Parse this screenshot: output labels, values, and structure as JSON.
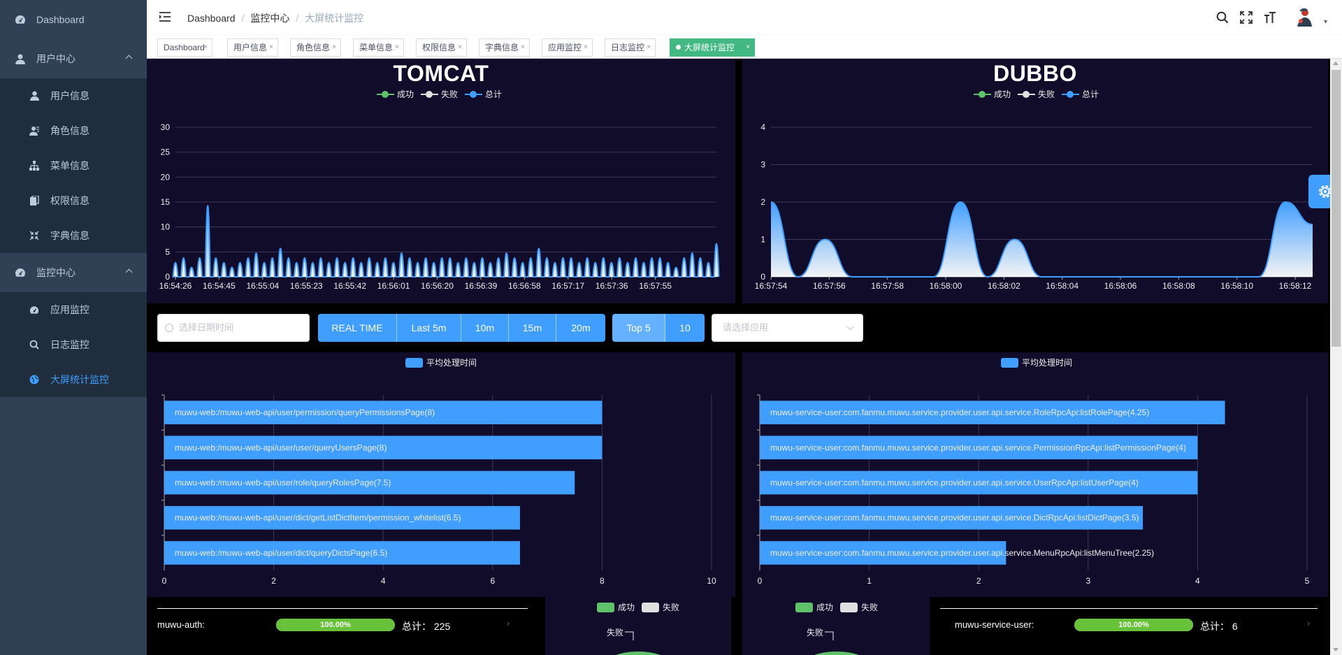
{
  "sidebar": {
    "dashboard": "Dashboard",
    "user_center": "用户中心",
    "user_info": "用户信息",
    "role_info": "角色信息",
    "menu_info": "菜单信息",
    "perm_info": "权限信息",
    "dict_info": "字典信息",
    "monitor_center": "监控中心",
    "app_monitor": "应用监控",
    "log_monitor": "日志监控",
    "screen_monitor": "大屏统计监控"
  },
  "breadcrumb": [
    "Dashboard",
    "监控中心",
    "大屏统计监控"
  ],
  "tags": [
    "Dashboard",
    "用户信息",
    "角色信息",
    "菜单信息",
    "权限信息",
    "字典信息",
    "应用监控",
    "日志监控",
    "大屏统计监控"
  ],
  "toolbar": {
    "date_placeholder": "选择日期时间",
    "range_buttons": [
      "REAL TIME",
      "Last 5m",
      "10m",
      "15m",
      "20m"
    ],
    "top_buttons": [
      "Top 5",
      "10"
    ],
    "app_placeholder": "请选择应用"
  },
  "legend": {
    "success": "成功",
    "fail": "失败",
    "total": "总计"
  },
  "colors": {
    "success": "#5fc26b",
    "fail": "#e0e0e0",
    "total": "#409eff",
    "panel": "#100c2a"
  },
  "chart_data": [
    {
      "type": "area",
      "title": "TOMCAT",
      "x_ticks": [
        "16:54:26",
        "16:54:45",
        "16:55:04",
        "16:55:23",
        "16:55:42",
        "16:56:01",
        "16:56:20",
        "16:56:39",
        "16:56:58",
        "16:57:17",
        "16:57:36",
        "16:57:55"
      ],
      "ylim": [
        0,
        30
      ],
      "y_ticks": [
        0,
        5,
        10,
        15,
        20,
        25,
        30
      ],
      "series": [
        {
          "name": "成功",
          "values": [
            3,
            4,
            2,
            4,
            15,
            4,
            3,
            2,
            3,
            4,
            5,
            3,
            4,
            6,
            4,
            3,
            4,
            3,
            4,
            3,
            4,
            3,
            4,
            3,
            4,
            3,
            4,
            3,
            5,
            4,
            3,
            4,
            3,
            4,
            4,
            3,
            4,
            3,
            4,
            3,
            4,
            5,
            4,
            3,
            4,
            6,
            4,
            3,
            4,
            4,
            3,
            4,
            3,
            4,
            3,
            4,
            3,
            4,
            3,
            4,
            4,
            3,
            2,
            4,
            5,
            4,
            3,
            7
          ]
        },
        {
          "name": "失败",
          "values": [
            0,
            0,
            0,
            0,
            0,
            0,
            0,
            0,
            0,
            0,
            0,
            0,
            0,
            0,
            0,
            0,
            0,
            0,
            0,
            0,
            0,
            0,
            0,
            0,
            0,
            0,
            0,
            0,
            0,
            0,
            0,
            0,
            0,
            0,
            0,
            0,
            0,
            0,
            0,
            0,
            0,
            0,
            0,
            0,
            0,
            0,
            0,
            0,
            0,
            0,
            0,
            0,
            0,
            0,
            0,
            0,
            0,
            0,
            0,
            0,
            0,
            0,
            0,
            0,
            0,
            0,
            0,
            0
          ]
        },
        {
          "name": "总计",
          "values": [
            3,
            4,
            2,
            4,
            15,
            4,
            3,
            2,
            3,
            4,
            5,
            3,
            4,
            6,
            4,
            3,
            4,
            3,
            4,
            3,
            4,
            3,
            4,
            3,
            4,
            3,
            4,
            3,
            5,
            4,
            3,
            4,
            3,
            4,
            4,
            3,
            4,
            3,
            4,
            3,
            4,
            5,
            4,
            3,
            4,
            6,
            4,
            3,
            4,
            4,
            3,
            4,
            3,
            4,
            3,
            4,
            3,
            4,
            3,
            4,
            4,
            3,
            2,
            4,
            5,
            4,
            3,
            7
          ]
        }
      ]
    },
    {
      "type": "area",
      "title": "DUBBO",
      "x_ticks": [
        "16:57:54",
        "16:57:56",
        "16:57:58",
        "16:58:00",
        "16:58:02",
        "16:58:04",
        "16:58:06",
        "16:58:08",
        "16:58:10",
        "16:58:12"
      ],
      "ylim": [
        0,
        4
      ],
      "y_ticks": [
        0,
        1,
        2,
        3,
        4
      ],
      "series": [
        {
          "name": "成功",
          "values": [
            2,
            0,
            1,
            0,
            0,
            0,
            0,
            2,
            0,
            1,
            0,
            0,
            0,
            0,
            0,
            0,
            0,
            0,
            0,
            2,
            1.4
          ]
        },
        {
          "name": "失败",
          "values": [
            0,
            0,
            0,
            0,
            0,
            0,
            0,
            0,
            0,
            0,
            0,
            0,
            0,
            0,
            0,
            0,
            0,
            0,
            0,
            0,
            0
          ]
        },
        {
          "name": "总计",
          "values": [
            2,
            0,
            1,
            0,
            0,
            0,
            0,
            2,
            0,
            1,
            0,
            0,
            0,
            0,
            0,
            0,
            0,
            0,
            0,
            2,
            1.4
          ]
        }
      ]
    },
    {
      "type": "bar",
      "legend": "平均处理时间",
      "xlim": [
        0,
        10
      ],
      "x_ticks": [
        0,
        2,
        4,
        6,
        8,
        10
      ],
      "categories": [
        "muwu-web:/muwu-web-api/user/permission/queryPermissionsPage(8)",
        "muwu-web:/muwu-web-api/user/user/queryUsersPage(8)",
        "muwu-web:/muwu-web-api/user/role/queryRolesPage(7.5)",
        "muwu-web:/muwu-web-api/user/dict/getListDictItem/permission_whitelist(6.5)",
        "muwu-web:/muwu-web-api/user/dict/queryDictsPage(6.5)"
      ],
      "values": [
        8,
        8,
        7.5,
        6.5,
        6.5
      ]
    },
    {
      "type": "bar",
      "legend": "平均处理时间",
      "xlim": [
        0,
        5
      ],
      "x_ticks": [
        0,
        1,
        2,
        3,
        4,
        5
      ],
      "categories": [
        "muwu-service-user:com.fanmu.muwu.service.provider.user.api.service.RoleRpcApi:listRolePage(4.25)",
        "muwu-service-user:com.fanmu.muwu.service.provider.user.api.service.PermissionRpcApi:listPermissionPage(4)",
        "muwu-service-user:com.fanmu.muwu.service.provider.user.api.service.UserRpcApi:listUserPage(4)",
        "muwu-service-user:com.fanmu.muwu.service.provider.user.api.service.DictRpcApi:listDictPage(3.5)",
        "muwu-service-user:com.fanmu.muwu.service.provider.user.api.service.MenuRpcApi:listMenuTree(2.25)"
      ],
      "values": [
        4.25,
        4,
        4,
        3.5,
        2.25
      ]
    }
  ],
  "stats": {
    "left": {
      "name": "muwu-auth:",
      "percent": "100.00%",
      "percent_value": 1.0,
      "total": "总计：  225"
    },
    "right": {
      "name": "muwu-service-user:",
      "percent": "100.00%",
      "percent_value": 1.0,
      "total": "总计：  6"
    },
    "pie_fail_label": "失败"
  }
}
